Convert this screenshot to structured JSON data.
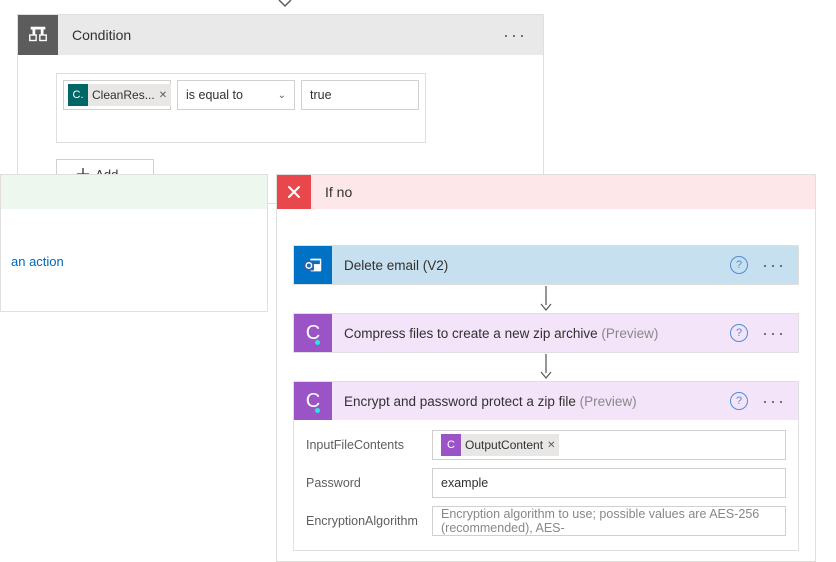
{
  "condition": {
    "title": "Condition",
    "token_label": "CleanRes...",
    "operator": "is equal to",
    "value": "true",
    "add_label": "Add"
  },
  "branches": {
    "yes": {
      "add_action_link": "an action"
    },
    "no": {
      "label": "If no",
      "actions": {
        "delete": {
          "title": "Delete email (V2)"
        },
        "compress": {
          "title": "Compress files to create a new zip archive",
          "preview": "(Preview)"
        },
        "encrypt": {
          "title": "Encrypt and password protect a zip file",
          "preview": "(Preview)",
          "fields": {
            "input_label": "InputFileContents",
            "input_token": "OutputContent",
            "password_label": "Password",
            "password_value": "example",
            "algo_label": "EncryptionAlgorithm",
            "algo_placeholder": "Encryption algorithm to use; possible values are AES-256 (recommended), AES-"
          }
        }
      }
    }
  }
}
